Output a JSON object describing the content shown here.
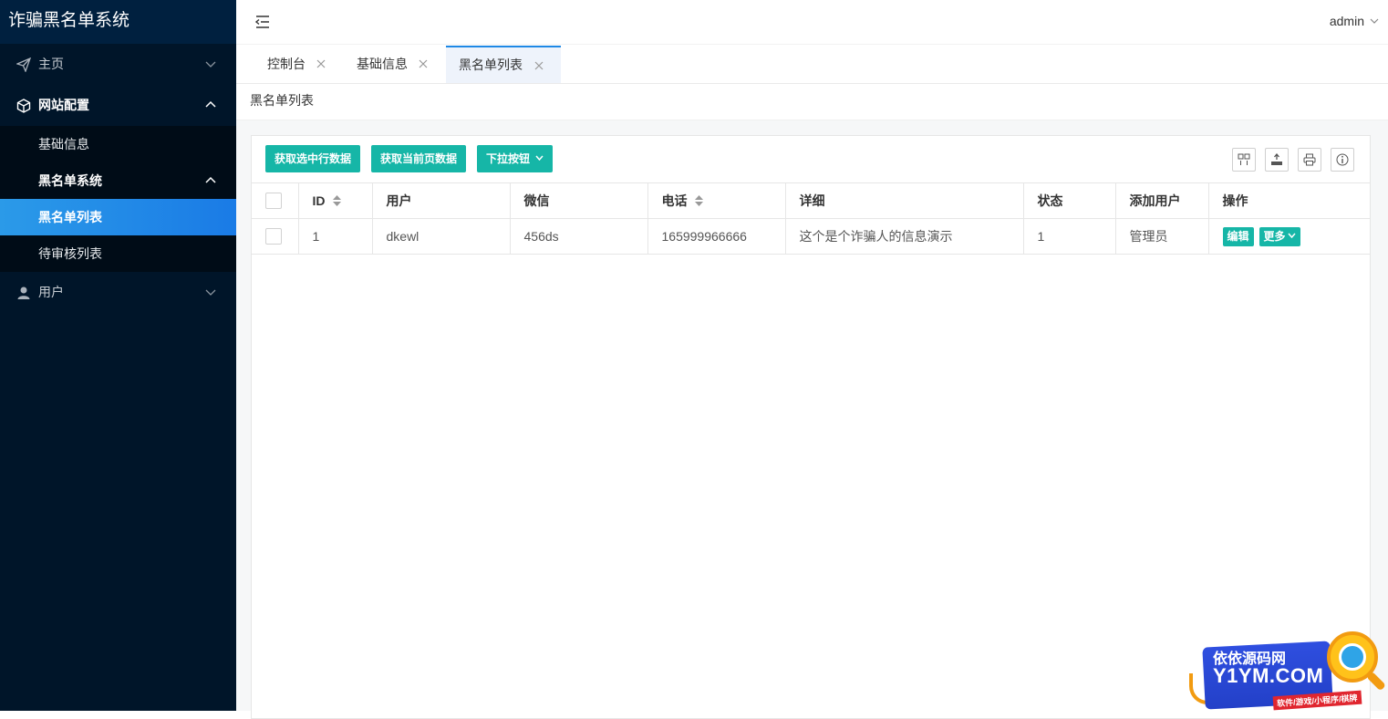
{
  "app": {
    "title": "诈骗黑名单系统"
  },
  "sidebar": {
    "items": [
      {
        "label": "主页",
        "icon": "paper-plane-icon"
      },
      {
        "label": "网站配置",
        "icon": "cube-icon",
        "children": [
          {
            "label": "基础信息"
          },
          {
            "label": "黑名单系统",
            "children": [
              {
                "label": "黑名单列表",
                "active": true
              },
              {
                "label": "待审核列表"
              }
            ]
          }
        ]
      },
      {
        "label": "用户",
        "icon": "user-icon"
      }
    ]
  },
  "header": {
    "user": "admin"
  },
  "tabs": [
    {
      "label": "控制台"
    },
    {
      "label": "基础信息"
    },
    {
      "label": "黑名单列表",
      "active": true
    }
  ],
  "breadcrumb": "黑名单列表",
  "toolbar": {
    "buttons": [
      "获取选中行数据",
      "获取当前页数据",
      "下拉按钮"
    ],
    "tools": [
      "columns-icon",
      "export-icon",
      "print-icon",
      "info-icon"
    ]
  },
  "table": {
    "columns": [
      "ID",
      "用户",
      "微信",
      "电话",
      "详细",
      "状态",
      "添加用户",
      "操作"
    ],
    "rows": [
      {
        "id": "1",
        "user": "dkewl",
        "wechat": "456ds",
        "phone": "165999966666",
        "detail": "这个是个诈骗人的信息演示",
        "status": "1",
        "added_by": "管理员",
        "actions": [
          "编辑",
          "更多"
        ]
      }
    ]
  },
  "watermark": {
    "line1": "依依源码网",
    "line2": "Y1YM.COM",
    "line3": "软件/游戏/小程序/棋牌"
  },
  "colors": {
    "sidebar": "#001529",
    "accent": "#16b6a7",
    "active": "#1e88e5"
  }
}
